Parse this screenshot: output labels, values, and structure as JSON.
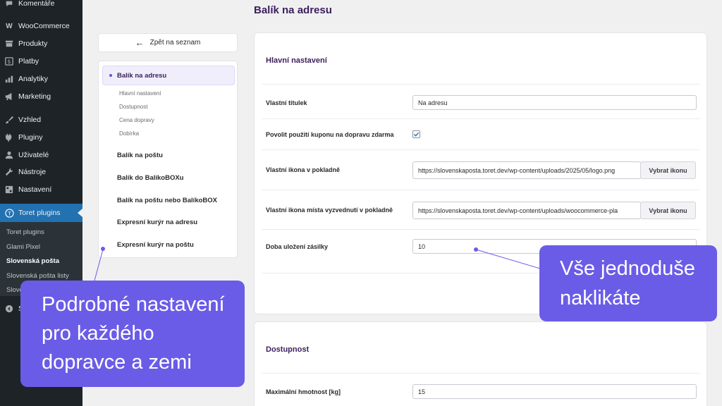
{
  "sidebar": {
    "items": [
      {
        "label": "Komentáře",
        "icon": "comment-icon"
      },
      {
        "label": "WooCommerce",
        "icon": "woocommerce-icon"
      },
      {
        "label": "Produkty",
        "icon": "archive-icon"
      },
      {
        "label": "Platby",
        "icon": "dollar-icon"
      },
      {
        "label": "Analytiky",
        "icon": "bar-chart-icon"
      },
      {
        "label": "Marketing",
        "icon": "megaphone-icon"
      },
      {
        "label": "Vzhled",
        "icon": "paintbrush-icon"
      },
      {
        "label": "Pluginy",
        "icon": "plugin-icon"
      },
      {
        "label": "Uživatelé",
        "icon": "user-icon"
      },
      {
        "label": "Nástroje",
        "icon": "wrench-icon"
      },
      {
        "label": "Nastavení",
        "icon": "settings-icon"
      },
      {
        "label": "Toret plugins",
        "icon": "toret-logo-icon"
      }
    ],
    "submenu": [
      "Toret plugins",
      "Glami Pixel",
      "Slovenská pošta",
      "Slovenská pošta listy",
      "Slove"
    ],
    "collapse_label": "S"
  },
  "page": {
    "title": "Balík na adresu"
  },
  "nav": {
    "back_label": "Zpět na seznam",
    "active_item": "Balík na adresu",
    "sub_items": [
      "Hlavní nastavení",
      "Dostupnost",
      "Cena dopravy",
      "Dobírka"
    ],
    "items": [
      "Balík na poštu",
      "Balík do BalíkoBOXu",
      "Balík na poštu nebo BalíkoBOX",
      "Expresní kurýr na adresu",
      "Expresní kurýr na poštu"
    ]
  },
  "main_settings": {
    "title": "Hlavní nastavení",
    "rows": [
      {
        "label": "Vlastní titulek",
        "value": "Na adresu"
      },
      {
        "label": "Povolit použití kuponu na dopravu zdarma",
        "checked": true
      },
      {
        "label": "Vlastní ikona v pokladně",
        "value": "https://slovenskaposta.toret.dev/wp-content/uploads/2025/05/logo.png",
        "button": "Vybrat ikonu"
      },
      {
        "label": "Vlastní ikona místa vyzvednutí v pokladně",
        "value": "https://slovenskaposta.toret.dev/wp-content/uploads/woocommerce-pla",
        "button": "Vybrat ikonu"
      },
      {
        "label": "Doba uložení zásilky",
        "value": "10"
      }
    ]
  },
  "availability": {
    "title": "Dostupnost",
    "rows": [
      {
        "label": "Maximální hmotnost [kg]",
        "value": "15"
      }
    ]
  },
  "callouts": {
    "left": [
      "Podrobné nastavení",
      "pro každého",
      "dopravce a zemi"
    ],
    "right": [
      "Vše jednoduše",
      "naklikáte"
    ]
  },
  "colors": {
    "accent": "#6b5ce7",
    "title": "#3b1f5c",
    "wp_active": "#2271b1",
    "wp_sidebar": "#1d2327"
  }
}
